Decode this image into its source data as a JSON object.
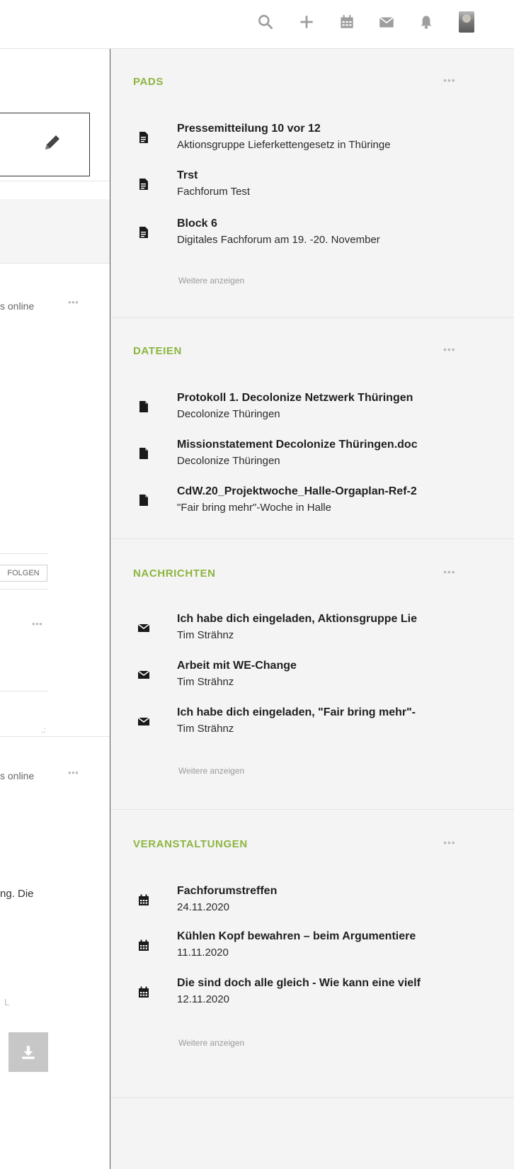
{
  "topbar": {
    "icons": [
      "search-icon",
      "plus-icon",
      "calendar-icon",
      "mail-icon",
      "bell-icon",
      "avatar"
    ]
  },
  "left": {
    "online_1": "s online",
    "follow_label": "FOLGEN",
    "online_2": "s online",
    "snippet": "ng. Die",
    "small_glyph": "L"
  },
  "sidebar": {
    "pads": {
      "title": "PADS",
      "items": [
        {
          "title": "Pressemitteilung 10 vor 12",
          "subtitle": "Aktionsgruppe Lieferkettengesetz in Thüringe"
        },
        {
          "title": "Trst",
          "subtitle": "Fachforum Test"
        },
        {
          "title": "Block 6",
          "subtitle": "Digitales Fachforum am 19. -20. November"
        }
      ],
      "more": "Weitere anzeigen"
    },
    "files": {
      "title": "DATEIEN",
      "items": [
        {
          "title": "Protokoll 1. Decolonize Netzwerk Thüringen",
          "subtitle": "Decolonize Thüringen"
        },
        {
          "title": "Missionstatement Decolonize Thüringen.doc",
          "subtitle": "Decolonize Thüringen"
        },
        {
          "title": "CdW.20_Projektwoche_Halle-Orgaplan-Ref-2",
          "subtitle": "\"Fair bring mehr\"-Woche in Halle"
        }
      ]
    },
    "messages": {
      "title": "NACHRICHTEN",
      "items": [
        {
          "title": "Ich habe dich eingeladen, Aktionsgruppe Lie",
          "subtitle": "Tim Strähnz"
        },
        {
          "title": "Arbeit mit WE-Change",
          "subtitle": "Tim Strähnz"
        },
        {
          "title": "Ich habe dich eingeladen, \"Fair bring mehr\"-",
          "subtitle": "Tim Strähnz"
        }
      ],
      "more": "Weitere anzeigen"
    },
    "events": {
      "title": "VERANSTALTUNGEN",
      "items": [
        {
          "title": "Fachforumstreffen",
          "subtitle": "24.11.2020"
        },
        {
          "title": "Kühlen Kopf bewahren – beim Argumentiere",
          "subtitle": "11.11.2020"
        },
        {
          "title": "Die sind doch alle gleich - Wie kann eine vielf",
          "subtitle": "12.11.2020"
        }
      ],
      "more": "Weitere anzeigen"
    }
  },
  "colors": {
    "accent_green": "#8db540",
    "sidebar_bg": "#f4f4f4",
    "icon_gray": "#9e9e9e"
  }
}
